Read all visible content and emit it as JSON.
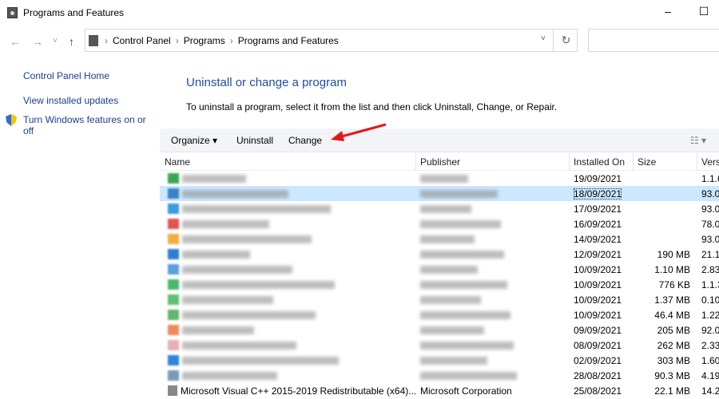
{
  "window": {
    "title": "Programs and Features",
    "minimize": "–",
    "maximize": "☐"
  },
  "address": {
    "back": "←",
    "forward": "→",
    "recent": "˅",
    "up": "↑",
    "crumbs": [
      "Control Panel",
      "Programs",
      "Programs and Features"
    ],
    "separator": "›",
    "dropdown": "˅",
    "refresh": "↻"
  },
  "sidebar": {
    "items": [
      "Control Panel Home",
      "View installed updates",
      "Turn Windows features on or off"
    ]
  },
  "main": {
    "heading": "Uninstall or change a program",
    "description": "To uninstall a program, select it from the list and then click Uninstall, Change, or Repair."
  },
  "toolbar": {
    "organize": "Organize ▾",
    "uninstall": "Uninstall",
    "change": "Change",
    "view": "☷ ▾"
  },
  "columns": [
    "Name",
    "Publisher",
    "Installed On",
    "Size",
    "Vers"
  ],
  "rows": [
    {
      "date": "19/09/2021",
      "size": "",
      "ver": "1.1.6",
      "color": "#3aa655"
    },
    {
      "date": "18/09/2021",
      "size": "",
      "ver": "93.0",
      "color": "#3b82c4",
      "selected": true
    },
    {
      "date": "17/09/2021",
      "size": "",
      "ver": "93.0",
      "color": "#3b9be0"
    },
    {
      "date": "16/09/2021",
      "size": "",
      "ver": "78.0",
      "color": "#e25454"
    },
    {
      "date": "14/09/2021",
      "size": "",
      "ver": "93.0",
      "color": "#f0b040"
    },
    {
      "date": "12/09/2021",
      "size": "190 MB",
      "ver": "21.1",
      "color": "#2f7fd0"
    },
    {
      "date": "10/09/2021",
      "size": "1.10 MB",
      "ver": "2.83",
      "color": "#5aa0e0"
    },
    {
      "date": "10/09/2021",
      "size": "776 KB",
      "ver": "1.1.3",
      "color": "#4cb86a"
    },
    {
      "date": "10/09/2021",
      "size": "1.37 MB",
      "ver": "0.10",
      "color": "#5cc070"
    },
    {
      "date": "10/09/2021",
      "size": "46.4 MB",
      "ver": "1.22",
      "color": "#62b86a"
    },
    {
      "date": "09/09/2021",
      "size": "205 MB",
      "ver": "92.0",
      "color": "#f08a5a"
    },
    {
      "date": "08/09/2021",
      "size": "262 MB",
      "ver": "2.33",
      "color": "#e8b0b0"
    },
    {
      "date": "02/09/2021",
      "size": "303 MB",
      "ver": "1.60",
      "color": "#2f86d8"
    },
    {
      "date": "28/08/2021",
      "size": "90.3 MB",
      "ver": "4.19",
      "color": "#7a9ab8"
    },
    {
      "date": "25/08/2021",
      "size": "22.1 MB",
      "ver": "14.2",
      "color": "#888",
      "name": "Microsoft Visual C++ 2015-2019 Redistributable (x64)...",
      "publisher": "Microsoft Corporation"
    }
  ]
}
